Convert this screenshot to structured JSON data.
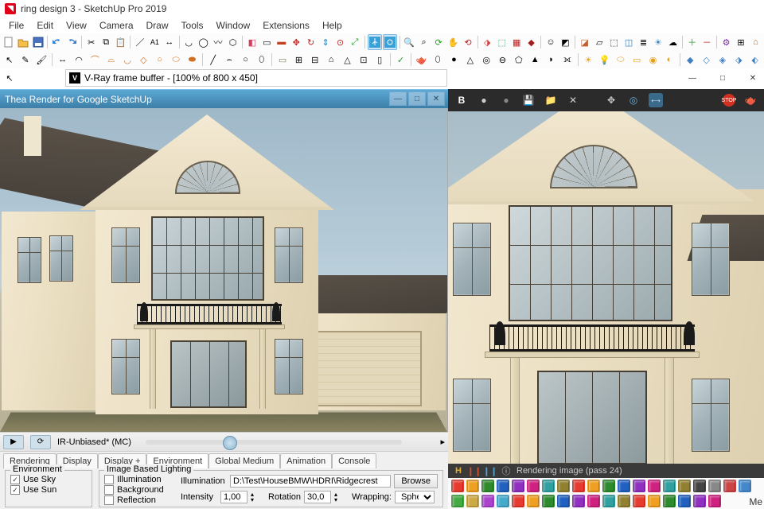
{
  "title": "ring design 3 - SketchUp Pro 2019",
  "menu": [
    "File",
    "Edit",
    "View",
    "Camera",
    "Draw",
    "Tools",
    "Window",
    "Extensions",
    "Help"
  ],
  "vfb_title": "V-Ray frame buffer - [100% of 800 x 450]",
  "thea_title": "Thea Render for Google SketchUp",
  "thea_mode": "IR-Unbiased* (MC)",
  "thea_tabs": [
    "Rendering",
    "Display",
    "Display +",
    "Environment",
    "Global Medium",
    "Animation",
    "Console"
  ],
  "thea_active_tab": "Environment",
  "env": {
    "group": "Environment",
    "use_sky": "Use Sky",
    "use_sun": "Use Sun"
  },
  "ibl": {
    "group": "Image Based Lighting",
    "illumination": "Illumination",
    "background": "Background",
    "reflection": "Reflection",
    "illum_label": "Illumination",
    "illum_path": "D:\\Test\\HouseBMW\\HDRI\\Ridgecrest",
    "browse": "Browse",
    "intensity_label": "Intensity",
    "intensity_value": "1,00",
    "rotation_label": "Rotation",
    "rotation_value": "30,0",
    "wrapping_label": "Wrapping:",
    "wrapping_value": "Spheri"
  },
  "vfb_status": "Rendering image (pass 24)",
  "vfb_channel": "B",
  "side_text": "Me",
  "color_icons": [
    "#e63b2e",
    "#f0a020",
    "#2d8a2d",
    "#2060c0",
    "#9030c0",
    "#d02080",
    "#30a0a0",
    "#908030",
    "#e63b2e",
    "#f0a020",
    "#2d8a2d",
    "#2060c0",
    "#9030c0",
    "#d02080",
    "#30a0a0",
    "#908030",
    "#444",
    "#888",
    "#c44",
    "#48c",
    "#4a4",
    "#ca4",
    "#a4c",
    "#4ac",
    "#e63b2e",
    "#f0a020",
    "#2d8a2d",
    "#2060c0",
    "#9030c0",
    "#d02080",
    "#30a0a0",
    "#908030",
    "#e63b2e",
    "#f0a020",
    "#2d8a2d",
    "#2060c0",
    "#9030c0",
    "#d02080"
  ]
}
